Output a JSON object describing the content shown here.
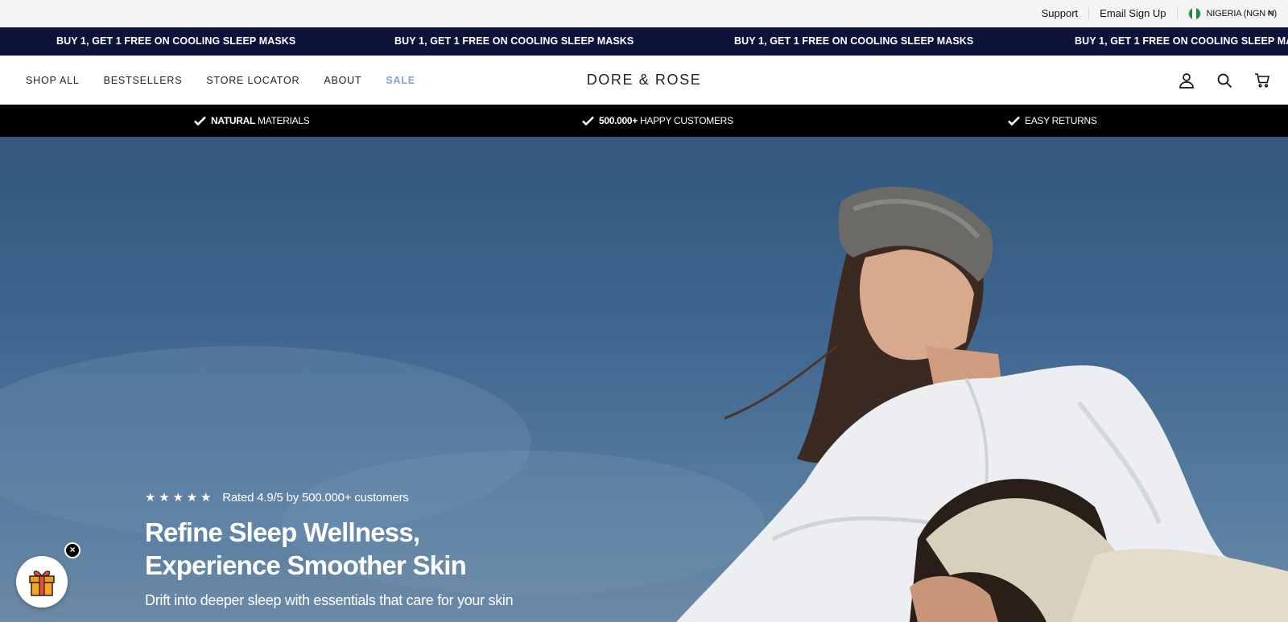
{
  "utility": {
    "support": "Support",
    "email_signup": "Email Sign Up",
    "region": "NIGERIA (NGN ₦)"
  },
  "announcement": {
    "messages": [
      "BUY 1, GET 1 FREE ON COOLING SLEEP MASKS",
      "BUY 1, GET 1 FREE ON COOLING SLEEP MASKS",
      "BUY 1, GET 1 FREE ON COOLING SLEEP MASKS",
      "BUY 1, GET 1 FREE ON COOLING SLEEP MASKS"
    ]
  },
  "header": {
    "logo": "DORE & ROSE",
    "nav": [
      "SHOP ALL",
      "BESTSELLERS",
      "STORE LOCATOR",
      "ABOUT",
      "SALE"
    ],
    "icons": [
      "account-icon",
      "search-icon",
      "cart-icon"
    ]
  },
  "usp": [
    {
      "bold": "NATURAL",
      "text": "MATERIALS"
    },
    {
      "bold": "500.000+",
      "text": "HAPPY CUSTOMERS"
    },
    {
      "bold": "",
      "text": "EASY RETURNS"
    }
  ],
  "hero": {
    "rating_text": "Rated 4.9/5 by 500.000+ customers",
    "stars": 5,
    "title_line1": "Refine Sleep Wellness,",
    "title_line2": "Experience Smoother Skin",
    "subtitle": "Drift into deeper sleep with essentials that care for your skin"
  },
  "colors": {
    "announcement_bg": "#0c1439",
    "sale": "#7ba3e0",
    "usp_bg": "#000000"
  }
}
